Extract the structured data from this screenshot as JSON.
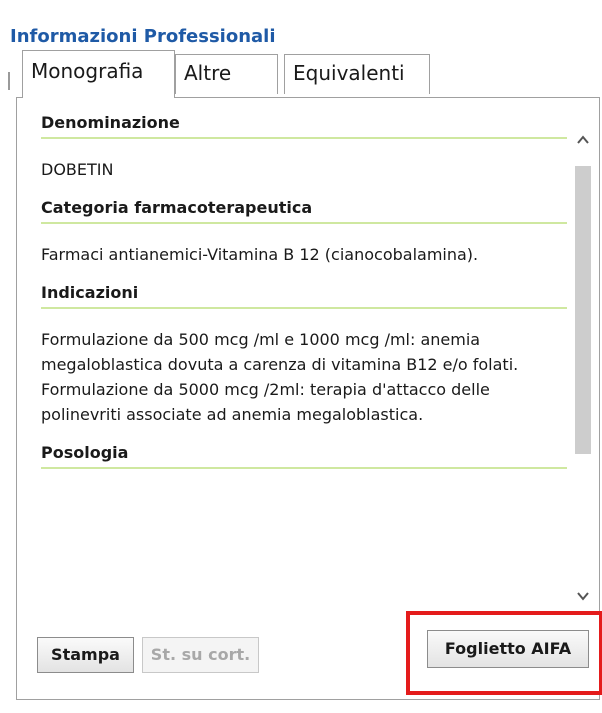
{
  "section_title": "Informazioni Professionali",
  "tabs": [
    {
      "label": "Monografia",
      "active": true
    },
    {
      "label": "Altre",
      "active": false
    },
    {
      "label": "Equivalenti",
      "active": false
    }
  ],
  "sections": [
    {
      "heading": "Denominazione",
      "text": "DOBETIN"
    },
    {
      "heading": "Categoria farmacoterapeutica",
      "text": "Farmaci antianemici-Vitamina B 12 (cianocobalamina)."
    },
    {
      "heading": "Indicazioni",
      "text": "Formulazione da 500 mcg /ml e 1000 mcg /ml: anemia megaloblastica dovuta a carenza di vitamina B12 e/o folati. Formulazione da 5000 mcg /2ml: terapia d'attacco delle polinevriti associate ad anemia megaloblastica."
    },
    {
      "heading": "Posologia",
      "text": ""
    }
  ],
  "buttons": {
    "stampa": "Stampa",
    "stampa_cortesia": "St. su cort.",
    "foglietto_aifa": "Foglietto AIFA"
  },
  "icons": {
    "scroll_up": "chevron-up-icon",
    "scroll_down": "chevron-down-icon"
  },
  "colors": {
    "section_title": "#1f5aa6",
    "heading_rule": "#cfe8a0",
    "highlight": "#e41b1b"
  }
}
